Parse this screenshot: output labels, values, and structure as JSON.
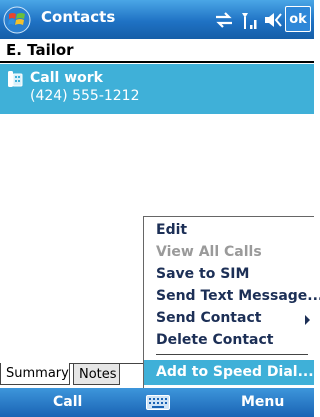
{
  "titlebar": {
    "title": "Contacts",
    "ok_label": "ok"
  },
  "contact": {
    "name": "E. Tailor"
  },
  "selected_item": {
    "label": "Call work",
    "number": "(424) 555-1212"
  },
  "menu": {
    "items": [
      {
        "label": "Edit",
        "enabled": true
      },
      {
        "label": "View All Calls",
        "enabled": false
      },
      {
        "label": "Save to SIM",
        "enabled": true
      },
      {
        "label": "Send Text Message...",
        "enabled": true
      },
      {
        "label": "Send Contact",
        "enabled": true,
        "submenu": true
      },
      {
        "label": "Delete Contact",
        "enabled": true
      }
    ],
    "highlighted": "Add to Speed Dial..."
  },
  "tabs": {
    "summary": "Summary",
    "notes": "Notes"
  },
  "softkeys": {
    "left": "Call",
    "right": "Menu"
  },
  "colors": {
    "title_bar": "#1f72c4",
    "highlight": "#3fb0d8",
    "menu_text": "#1c2f56"
  }
}
